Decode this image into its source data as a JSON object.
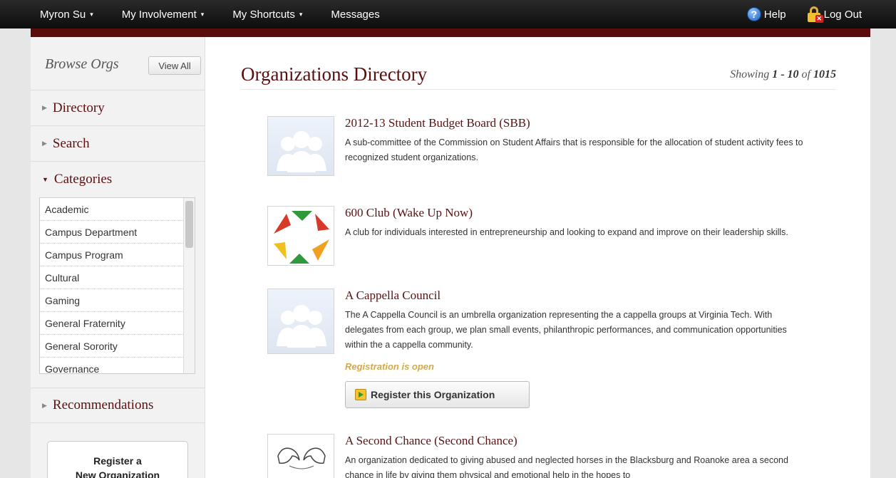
{
  "topnav": {
    "user_label": "Myron Su",
    "involvement_label": "My Involvement",
    "shortcuts_label": "My Shortcuts",
    "messages_label": "Messages",
    "help_label": "Help",
    "logout_label": "Log Out",
    "caret": "▾"
  },
  "sidebar": {
    "browse_title": "Browse Orgs",
    "view_all_label": "View All",
    "directory_label": "Directory",
    "search_label": "Search",
    "categories_label": "Categories",
    "recommendations_label": "Recommendations",
    "categories": [
      "Academic",
      "Campus Department",
      "Campus Program",
      "Cultural",
      "Gaming",
      "General Fraternity",
      "General Sorority",
      "Governance"
    ],
    "register_line1": "Register a",
    "register_line2": "New Organization"
  },
  "main": {
    "title": "Organizations Directory",
    "showing_prefix": "Showing",
    "showing_range": "1 - 10",
    "showing_of": "of",
    "showing_total": "1015",
    "orgs": [
      {
        "name": "2012-13 Student Budget Board (SBB)",
        "description": "A sub-committee of the Commission on Student Affairs that is responsible for the allocation of student activity fees to recognized student organizations."
      },
      {
        "name": "600 Club (Wake Up Now)",
        "description": "A club for individuals interested in entrepreneurship and looking to expand and improve on their leadership skills."
      },
      {
        "name": "A Cappella Council",
        "description": "The A Cappella Council is an umbrella organization representing the a cappella groups at Virginia Tech. With delegates from each group, we plan small events, philanthropic performances, and communication opportunities within the a cappella community.",
        "status": "Registration is open",
        "register_button": "Register this Organization"
      },
      {
        "name": "A Second Chance (Second Chance)",
        "description": "An organization dedicated to giving abused and neglected horses in the Blacksburg and Roanoke area a second chance in life by giving them physical and emotional help in the hopes to"
      }
    ]
  }
}
